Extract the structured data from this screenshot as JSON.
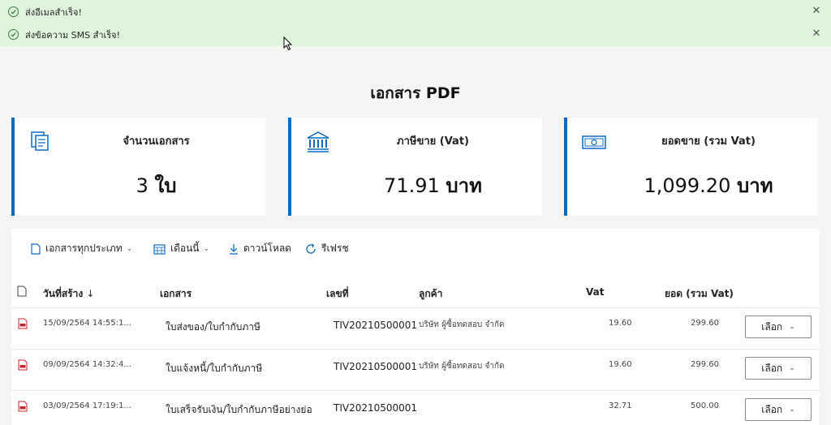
{
  "notifications": [
    {
      "text": "ส่งอีเมลสำเร็จ!"
    },
    {
      "text": "ส่งข้อความ SMS สำเร็จ!"
    }
  ],
  "page": {
    "title": "เอกสาร PDF"
  },
  "cards": [
    {
      "label": "จำนวนเอกสาร",
      "value": "3",
      "unit": "ใบ",
      "icon": "documents-icon"
    },
    {
      "label": "ภาษีขาย (Vat)",
      "value": "71.91",
      "unit": "บาท",
      "icon": "bank-icon"
    },
    {
      "label": "ยอดขาย (รวม Vat)",
      "value": "1,099.20",
      "unit": "บาท",
      "icon": "money-icon"
    }
  ],
  "toolbar": {
    "doc_type": "เอกสารทุกประเภท",
    "period": "เดือนนี้",
    "download": "ดาวน์โหลด",
    "refresh": "รีเฟรช"
  },
  "table": {
    "headers": {
      "created": "วันที่สร้าง",
      "document": "เอกสาร",
      "number": "เลขที่",
      "customer": "ลูกค้า",
      "vat": "Vat",
      "total": "ยอด (รวม Vat)"
    },
    "rows": [
      {
        "created": "15/09/2564 14:55:1...",
        "document": "ใบส่งของ/ใบกำกับภาษี",
        "number": "TIV20210500001",
        "customer": "บริษัท ผู้ซื้อทดสอบ จำกัด",
        "vat": "19.60",
        "total": "299.60",
        "action": "เลือก"
      },
      {
        "created": "09/09/2564 14:32:4...",
        "document": "ใบแจ้งหนี้/ใบกำกับภาษี",
        "number": "TIV20210500001",
        "customer": "บริษัท ผู้ซื้อทดสอบ จำกัด",
        "vat": "19.60",
        "total": "299.60",
        "action": "เลือก"
      },
      {
        "created": "03/09/2564 17:19:1...",
        "document": "ใบเสร็จรับเงิน/ใบกำกับภาษีอย่างย่อ",
        "number": "TIV20210500001",
        "customer": "",
        "vat": "32.71",
        "total": "500.00",
        "action": "เลือก"
      }
    ]
  },
  "colors": {
    "accent": "#0b6bc2",
    "success_bg": "#dff6dd",
    "pdf_red": "#c4262e"
  }
}
